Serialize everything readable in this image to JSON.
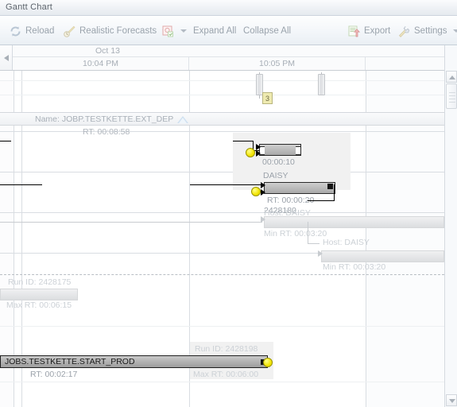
{
  "window": {
    "title": "Gantt Chart"
  },
  "toolbar": {
    "reload": {
      "label": "Reload",
      "icon": "reload-icon"
    },
    "forecasts": {
      "label": "Realistic Forecasts",
      "icon": "forecast-icon",
      "caret": true
    },
    "filter": {
      "label": "",
      "icon": "filter-icon",
      "caret": true
    },
    "expand_all": {
      "label": "Expand All"
    },
    "collapse_all": {
      "label": "Collapse All"
    },
    "export": {
      "label": "Export",
      "icon": "export-icon"
    },
    "settings": {
      "label": "Settings",
      "icon": "settings-icon",
      "caret": true
    }
  },
  "timeline": {
    "date_label": "Oct 13",
    "columns": [
      {
        "label": "10:04 PM"
      },
      {
        "label": "10:05 PM"
      },
      {
        "label": ""
      }
    ],
    "marker_badge": "3"
  },
  "group": {
    "label": "Name: JOBP.TESTKETTE.EXT_DEP",
    "runtime": "RT: 00:08:58",
    "collapse_icon": "triangle-up-icon"
  },
  "tasks": [
    {
      "id": "task-2428180",
      "top_label": "2428180",
      "bottom_label": "00:00:10",
      "state": "active"
    },
    {
      "id": "task-daisy",
      "top_label": "DAISY",
      "bottom_label": "RT: 00:00:20",
      "state": "active"
    },
    {
      "id": "task-host-daisy-1",
      "top_label": "Host: DAISY",
      "bottom_label": "Min RT: 00:03:20",
      "state": "forecast"
    },
    {
      "id": "task-host-daisy-2",
      "top_label": "Host: DAISY",
      "bottom_label": "Min RT: 00:03:20",
      "state": "forecast"
    },
    {
      "id": "task-2428175",
      "top_label": "Run ID: 2428175",
      "bottom_label": "Max RT: 00:06:15",
      "state": "forecast"
    },
    {
      "id": "task-start-prod",
      "bar_label": "JOBS.TESTKETTE.START_PROD",
      "bottom_label": "RT: 00:02:17",
      "top_label_right": "Run ID: 2428198",
      "bottom_label_right": "Max RT: 00:06:00",
      "state": "active"
    }
  ],
  "colors": {
    "accent": "#f2e400",
    "bar_fill": "#bdbdbd",
    "bar_border": "#2b2b2b",
    "ghost_fill": "#e6e7e9",
    "text_muted": "#a9b0b8",
    "chrome": "#eef1f5"
  }
}
